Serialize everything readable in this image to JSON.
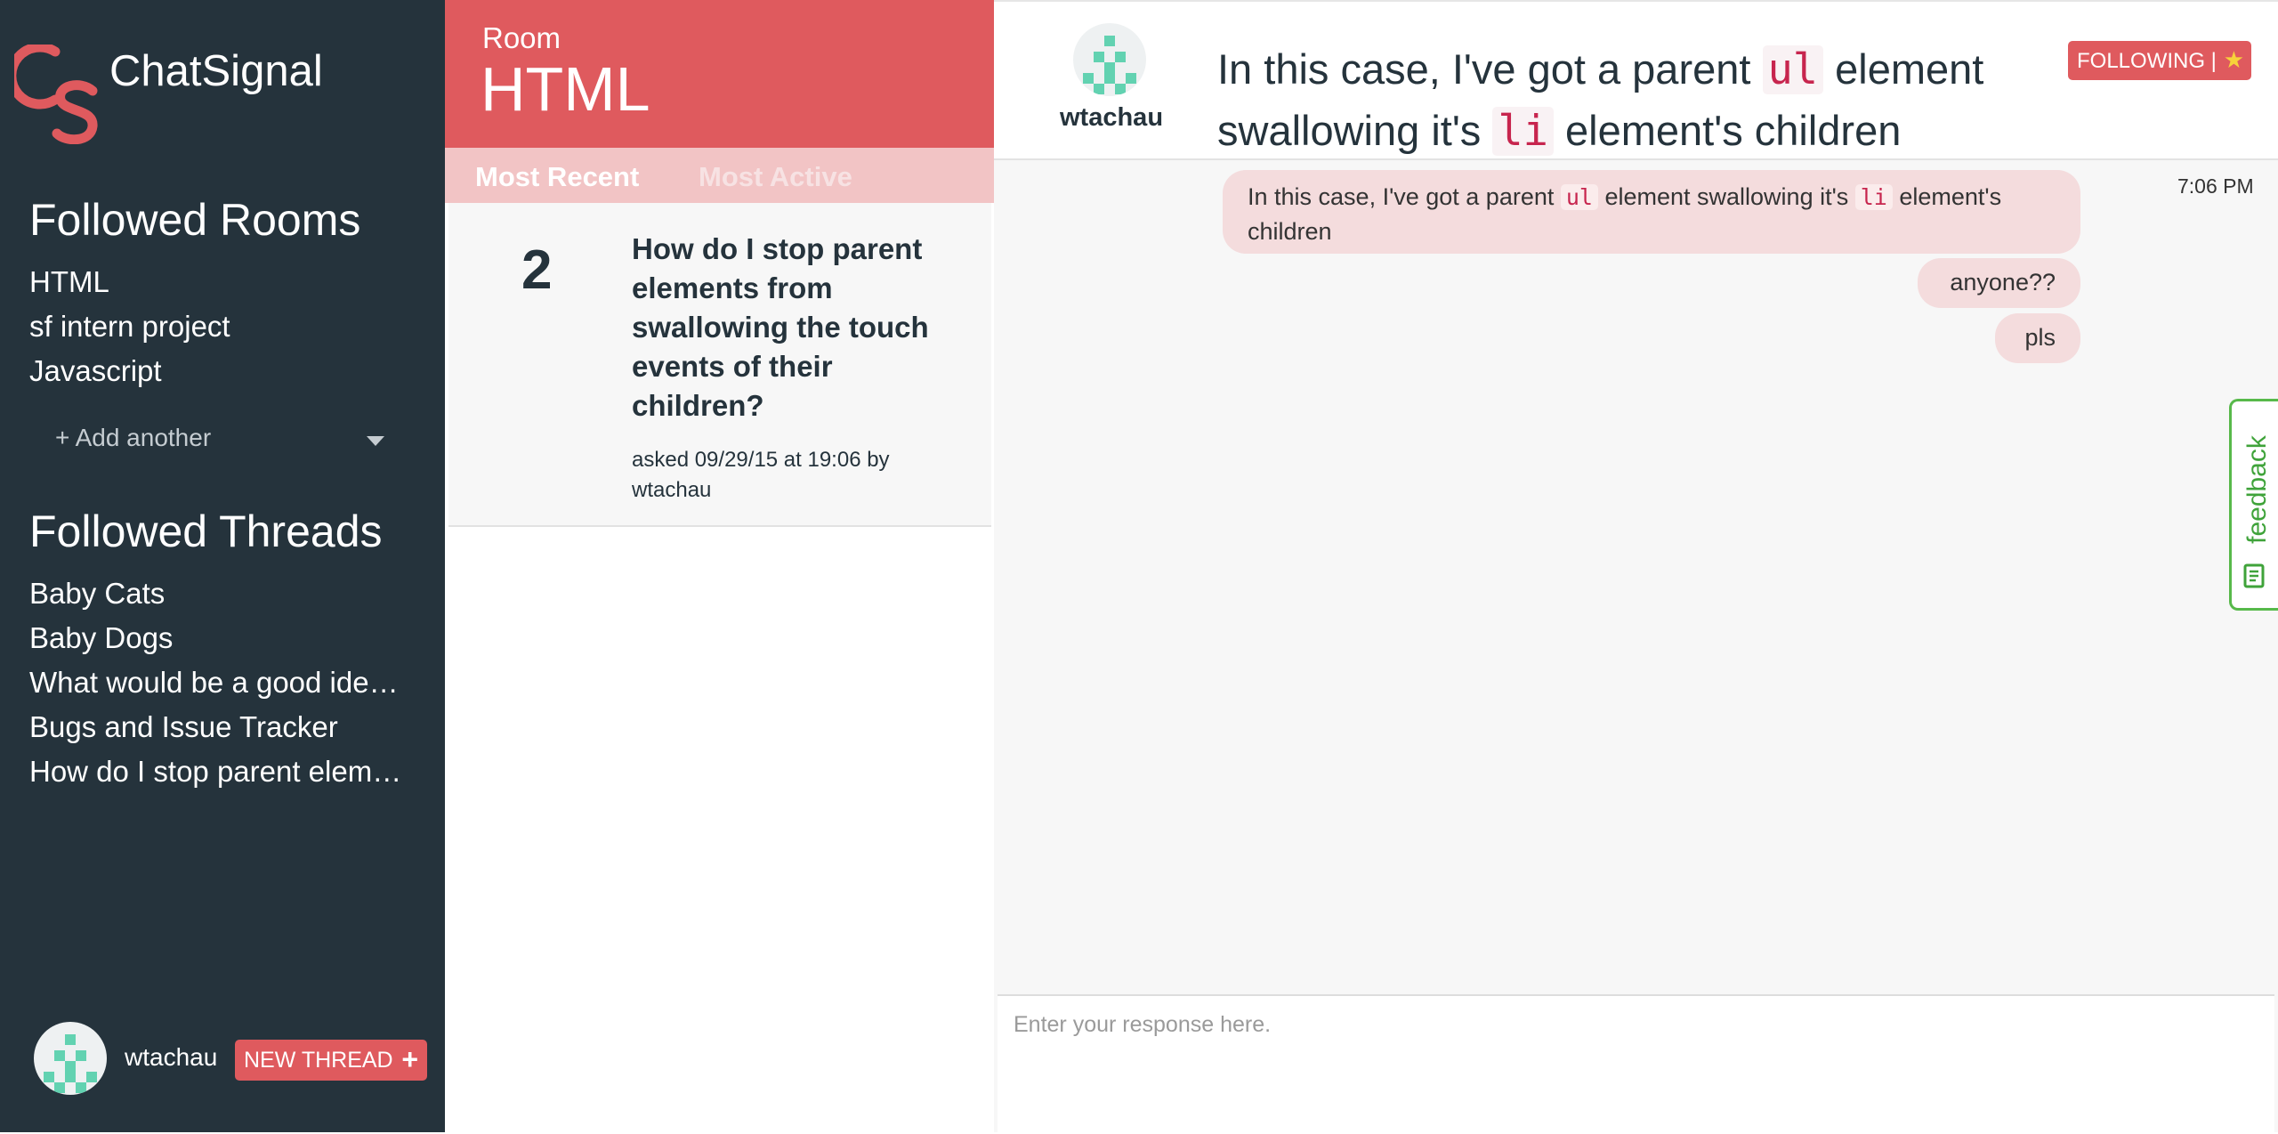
{
  "app": {
    "title": "ChatSignal",
    "logo_letters": "CS"
  },
  "sidebar": {
    "followed_rooms_heading": "Followed Rooms",
    "rooms": [
      {
        "label": "HTML"
      },
      {
        "label": "sf intern project"
      },
      {
        "label": "Javascript"
      }
    ],
    "add_another_label": "+ Add another",
    "followed_threads_heading": "Followed Threads",
    "threads": [
      {
        "label": "Baby Cats"
      },
      {
        "label": "Baby Dogs"
      },
      {
        "label": "What would be a good ide…"
      },
      {
        "label": "Bugs and Issue Tracker"
      },
      {
        "label": "How do I stop parent elem…"
      }
    ],
    "user_name": "wtachau",
    "new_thread_label": "NEW THREAD",
    "new_thread_icon": "plus-icon"
  },
  "room": {
    "label": "Room",
    "name": "HTML",
    "tabs": [
      {
        "label": "Most Recent",
        "active": true
      },
      {
        "label": "Most Active",
        "active": false
      }
    ],
    "thread_card": {
      "count": "2",
      "title": "How do I stop parent elements from swallowing the touch events of their children?",
      "meta": "asked 09/29/15 at 19:06 by wtachau"
    }
  },
  "main": {
    "op_name": "wtachau",
    "heading": {
      "part1": "In this case, I've got a parent ",
      "code1": "ul",
      "part2": " element swallowing it's ",
      "code2": "li",
      "part3": " element's children"
    },
    "following_label": "FOLLOWING |",
    "following_icon": "star-icon",
    "messages": [
      {
        "part1": "In this case, I've got a parent ",
        "code1": "ul",
        "part2": " element swallowing it's ",
        "code2": "li",
        "part3": " element's children"
      },
      {
        "text": "anyone??"
      },
      {
        "text": "pls"
      }
    ],
    "timestamp": "7:06 PM",
    "feedback_label": "feedback",
    "reply_placeholder": "Enter your response here."
  },
  "colors": {
    "sidebar_bg": "#25333c",
    "accent": "#df5a5e",
    "tabs_bg": "#f2c4c5",
    "bubble_bg": "#f4dcdd",
    "avatar_pattern": "#62d2b1",
    "feedback_green": "#57b94a"
  }
}
